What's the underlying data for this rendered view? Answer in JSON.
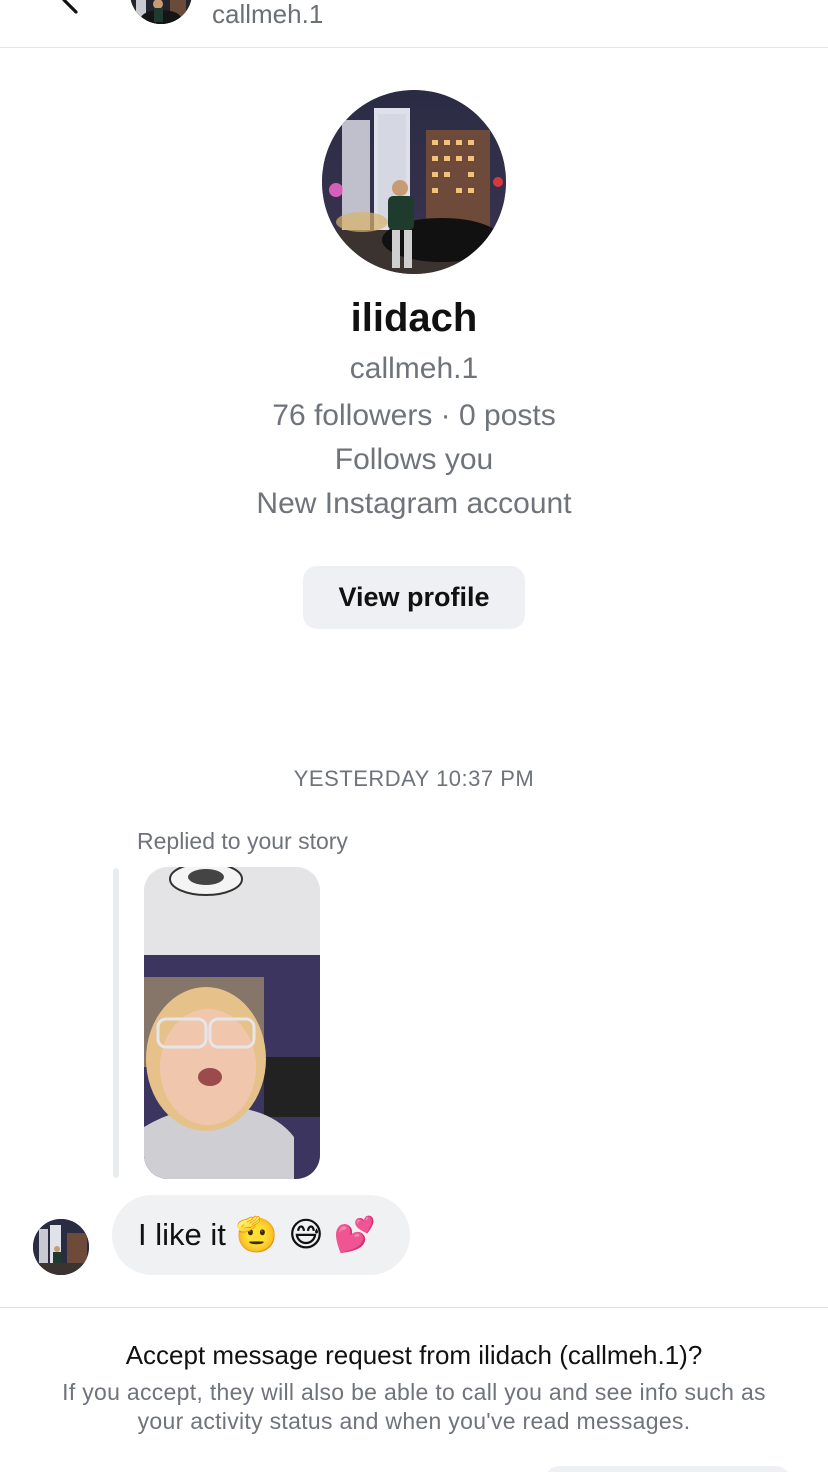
{
  "header": {
    "username": "callmeh.1"
  },
  "profile": {
    "display_name": "ilidach",
    "handle": "callmeh.1",
    "stats": "76 followers · 0 posts",
    "follows_status": "Follows you",
    "account_note": "New Instagram account",
    "view_profile_label": "View profile"
  },
  "conversation": {
    "timestamp": "YESTERDAY 10:37 PM",
    "replied_label": "Replied to your story",
    "message_text": "I like it",
    "message_emojis": [
      "🫡",
      "😅",
      "💕"
    ]
  },
  "request": {
    "title": "Accept message request from ilidach (callmeh.1)?",
    "info": "If you accept, they will also be able to call you and see info such as your activity status and when you've read messages."
  },
  "icons": {
    "back": "chevron-left-icon"
  },
  "colors": {
    "secondary_text": "#6f737a",
    "button_bg": "#eef0f3",
    "bubble_bg": "#eff1f3"
  }
}
